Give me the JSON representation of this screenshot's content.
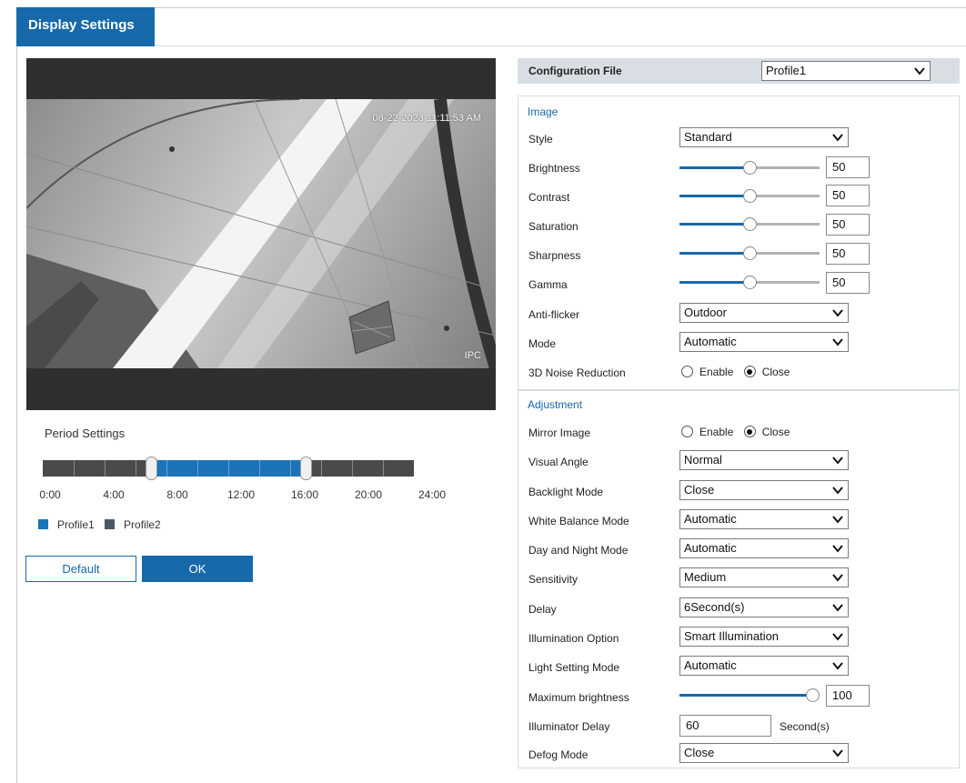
{
  "tab": {
    "label": "Display Settings"
  },
  "preview": {
    "osd_time": "08-22-2023 11:11:53 AM",
    "osd_name": "IPC"
  },
  "period": {
    "title": "Period Settings",
    "time_labels": [
      "0:00",
      "4:00",
      "8:00",
      "12:00",
      "16:00",
      "20:00",
      "24:00"
    ],
    "profile1_start_hour": 7,
    "profile1_end_hour": 17,
    "legend": [
      {
        "label": "Profile1",
        "color": "#1b73b8"
      },
      {
        "label": "Profile2",
        "color": "#4a5866"
      }
    ]
  },
  "buttons": {
    "default": "Default",
    "ok": "OK"
  },
  "config_file": {
    "label": "Configuration File",
    "value": "Profile1"
  },
  "image": {
    "title": "Image",
    "style": {
      "label": "Style",
      "value": "Standard"
    },
    "brightness": {
      "label": "Brightness",
      "value": "50",
      "fraction": 0.5
    },
    "contrast": {
      "label": "Contrast",
      "value": "50",
      "fraction": 0.5
    },
    "saturation": {
      "label": "Saturation",
      "value": "50",
      "fraction": 0.5
    },
    "sharpness": {
      "label": "Sharpness",
      "value": "50",
      "fraction": 0.5
    },
    "gamma": {
      "label": "Gamma",
      "value": "50",
      "fraction": 0.5
    },
    "anti_flicker": {
      "label": "Anti-flicker",
      "value": "Outdoor"
    },
    "mode": {
      "label": "Mode",
      "value": "Automatic"
    },
    "noise_reduction": {
      "label": "3D Noise Reduction",
      "enable": "Enable",
      "close": "Close",
      "selected": "Close"
    }
  },
  "adjustment": {
    "title": "Adjustment",
    "mirror": {
      "label": "Mirror Image",
      "enable": "Enable",
      "close": "Close",
      "selected": "Close"
    },
    "visual_angle": {
      "label": "Visual Angle",
      "value": "Normal"
    },
    "backlight": {
      "label": "Backlight Mode",
      "value": "Close"
    },
    "white_balance": {
      "label": "White Balance Mode",
      "value": "Automatic"
    },
    "day_night": {
      "label": "Day and Night Mode",
      "value": "Automatic"
    },
    "sensitivity": {
      "label": "Sensitivity",
      "value": "Medium"
    },
    "delay": {
      "label": "Delay",
      "value": "6Second(s)"
    },
    "illumination": {
      "label": "Illumination Option",
      "value": "Smart Illumination"
    },
    "light_setting": {
      "label": "Light Setting Mode",
      "value": "Automatic"
    },
    "max_brightness": {
      "label": "Maximum brightness",
      "value": "100",
      "fraction": 1.0
    },
    "illuminator_delay": {
      "label": "Illuminator Delay",
      "value": "60",
      "unit": "Second(s)"
    },
    "defog": {
      "label": "Defog Mode",
      "value": "Close"
    }
  },
  "colors": {
    "accent": "#1769aa"
  }
}
